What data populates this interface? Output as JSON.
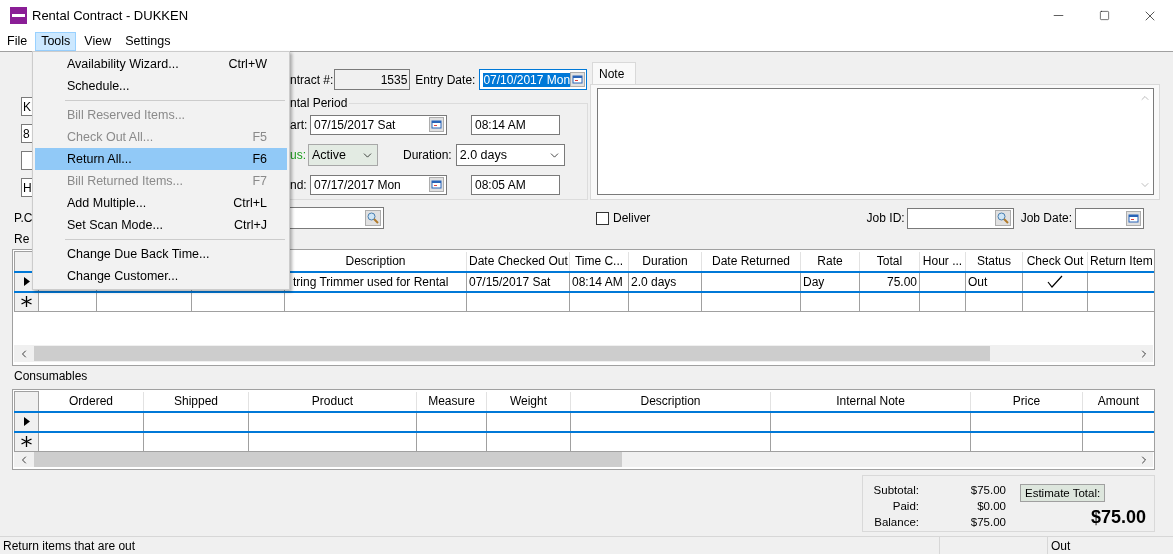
{
  "window": {
    "title": "Rental Contract - DUKKEN"
  },
  "menu_bar": [
    {
      "label": "File",
      "selected": false
    },
    {
      "label": "Tools",
      "selected": true
    },
    {
      "label": "View",
      "selected": false
    },
    {
      "label": "Settings",
      "selected": false
    }
  ],
  "tools_menu": {
    "items": [
      {
        "kind": "item",
        "label": "Availability Wizard...",
        "shortcut": "Ctrl+W",
        "disabled": false,
        "selected": false
      },
      {
        "kind": "item",
        "label": "Schedule...",
        "disabled": false,
        "selected": false
      },
      {
        "kind": "separator"
      },
      {
        "kind": "item",
        "label": "Bill Reserved Items...",
        "disabled": true,
        "selected": false
      },
      {
        "kind": "item",
        "label": "Check Out All...",
        "shortcut": "F5",
        "disabled": true,
        "selected": false
      },
      {
        "kind": "item",
        "label": "Return All...",
        "shortcut": "F6",
        "disabled": false,
        "selected": true
      },
      {
        "kind": "item",
        "label": "Bill Returned Items...",
        "shortcut": "F7",
        "disabled": true,
        "selected": false
      },
      {
        "kind": "item",
        "label": "Add Multiple...",
        "shortcut": "Ctrl+L",
        "disabled": false,
        "selected": false
      },
      {
        "kind": "item",
        "label": "Set Scan Mode...",
        "shortcut": "Ctrl+J",
        "disabled": false,
        "selected": false
      },
      {
        "kind": "separator"
      },
      {
        "kind": "item",
        "label": "Change Due Back Time...",
        "disabled": false,
        "selected": false
      },
      {
        "kind": "item",
        "label": "Change Customer...",
        "disabled": false,
        "selected": false
      }
    ]
  },
  "customer_fields": [
    {
      "kind": "text",
      "value": "K"
    },
    {
      "kind": "text",
      "value": "8"
    },
    {
      "kind": "blank"
    },
    {
      "kind": "text",
      "value": "H"
    }
  ],
  "contract": {
    "number_label": "ntract #:",
    "number": "1535",
    "entry_date_label": "Entry Date:",
    "entry_date": "07/10/2017 Mon",
    "entry_date_text_selected": true
  },
  "rental_period": {
    "title": "ntal Period",
    "start_label": "art:",
    "start_date": "07/15/2017 Sat",
    "start_time": "08:14 AM",
    "status_label": "us:",
    "status": "Active",
    "duration_label": "Duration:",
    "duration": "2.0 days",
    "end_label": "nd:",
    "end_date": "07/17/2017 Mon",
    "end_time": "08:05 AM"
  },
  "note": {
    "tab": "Note"
  },
  "po_label": "P.C",
  "deliver": {
    "label": "Deliver",
    "checked": false
  },
  "job_id": {
    "label": "Job ID:"
  },
  "job_date": {
    "label": "Job Date:"
  },
  "rentals": {
    "label": "Re",
    "columns": [
      "Description",
      "Date Checked Out",
      "Time C...",
      "Duration",
      "Date Returned",
      "Rate",
      "Total",
      "Hour ...",
      "Status",
      "Check Out",
      "Return Item"
    ],
    "rows": [
      {
        "description": "tring Trimmer used for Rental",
        "date_checked_out": "07/15/2017 Sat",
        "time_checked_out": "08:14 AM",
        "duration": "2.0 days",
        "rate": "Day",
        "total": "75.00",
        "status": "Out",
        "checked_out": true,
        "selected": true
      }
    ]
  },
  "consumables": {
    "label": "Consumables",
    "columns": [
      "Ordered",
      "Shipped",
      "Product",
      "Measure",
      "Weight",
      "Description",
      "Internal Note",
      "Price",
      "Amount"
    ],
    "rows": [
      {
        "selected": true
      }
    ]
  },
  "totals": {
    "subtotal_label": "Subtotal:",
    "subtotal": "$75.00",
    "paid_label": "Paid:",
    "paid": "$0.00",
    "balance_label": "Balance:",
    "balance": "$75.00",
    "estimate_button": "Estimate Total:",
    "grand_total": "$75.00"
  },
  "status_bar": {
    "message": "Return items that are out",
    "status": "Out"
  }
}
